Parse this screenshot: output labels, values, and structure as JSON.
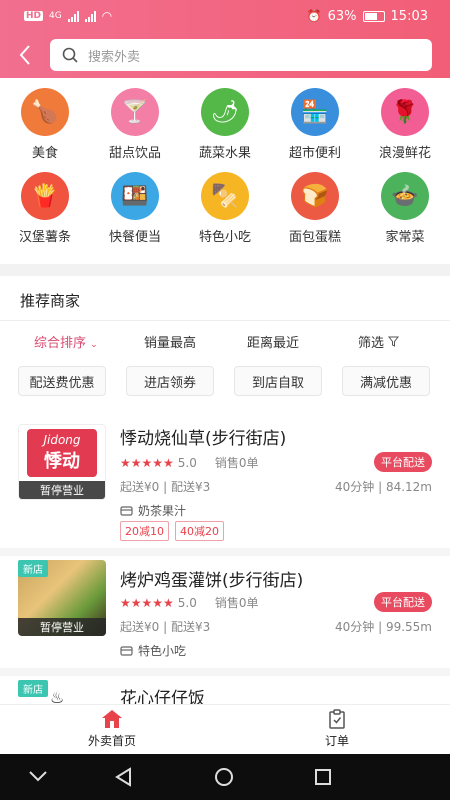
{
  "status_bar": {
    "network": "HD",
    "signal_label": "4G",
    "battery": "63%",
    "time": "15:03"
  },
  "search": {
    "placeholder": "搜索外卖"
  },
  "categories": [
    {
      "label": "美食",
      "icon": "chicken-icon",
      "color": "#f07a3a"
    },
    {
      "label": "甜点饮品",
      "icon": "cocktail-icon",
      "color": "#f47fa6"
    },
    {
      "label": "蔬菜水果",
      "icon": "vegetable-icon",
      "color": "#54b848"
    },
    {
      "label": "超市便利",
      "icon": "store-icon",
      "color": "#3a8fdc"
    },
    {
      "label": "浪漫鲜花",
      "icon": "rose-icon",
      "color": "#f25d93"
    },
    {
      "label": "汉堡薯条",
      "icon": "fries-icon",
      "color": "#f0533e"
    },
    {
      "label": "快餐便当",
      "icon": "bento-icon",
      "color": "#3ba7e4"
    },
    {
      "label": "特色小吃",
      "icon": "skewer-icon",
      "color": "#f6b623"
    },
    {
      "label": "面包蛋糕",
      "icon": "bread-icon",
      "color": "#ec5a44"
    },
    {
      "label": "家常菜",
      "icon": "dish-icon",
      "color": "#4db25c"
    }
  ],
  "recommended": {
    "title": "推荐商家",
    "sort_options": [
      "综合排序",
      "销量最高",
      "距离最近",
      "筛选"
    ],
    "chips": [
      "配送费优惠",
      "进店领券",
      "到店自取",
      "满减优惠"
    ]
  },
  "stores": [
    {
      "name": "悸动烧仙草(步行街店)",
      "logo_text_top": "Jidong",
      "logo_text_bottom": "悸动",
      "rating": "5.0",
      "sales": "销售0单",
      "badge": "平台配送",
      "fees": "起送¥0 | 配送¥3",
      "distance": "40分钟 | 84.12m",
      "category": "奶茶果汁",
      "promos": [
        "20减10",
        "40减20"
      ],
      "status": "暂停营业",
      "new": false
    },
    {
      "name": "烤炉鸡蛋灌饼(步行街店)",
      "rating": "5.0",
      "sales": "销售0单",
      "badge": "平台配送",
      "fees": "起送¥0 | 配送¥3",
      "distance": "40分钟 | 99.55m",
      "category": "特色小吃",
      "status": "暂停营业",
      "new_label": "新店",
      "new": true
    },
    {
      "name": "花心仔仔饭",
      "new_label": "新店",
      "new": true
    }
  ],
  "tabbar": {
    "home": "外卖首页",
    "orders": "订单"
  },
  "colors": {
    "primary": "#f26f8f",
    "accent": "#e84a5f",
    "new_tag": "#3cc6b1"
  }
}
